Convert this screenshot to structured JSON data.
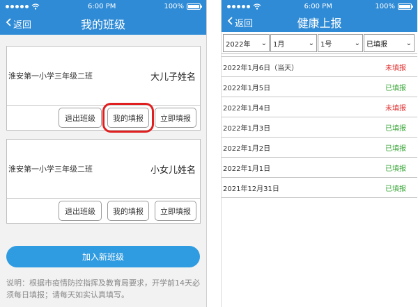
{
  "status_bar": {
    "carrier_dots": 5,
    "time": "6:00 PM",
    "battery": "100%"
  },
  "left": {
    "nav": {
      "back_label": "返回",
      "title": "我的班级"
    },
    "cards": [
      {
        "class_name": "淮安第一小学三年级二班",
        "child_name": "大儿子姓名",
        "buttons": {
          "exit": "退出班级",
          "my_report": "我的填报",
          "report_now": "立即填报"
        }
      },
      {
        "class_name": "淮安第一小学三年级二班",
        "child_name": "小女儿姓名",
        "buttons": {
          "exit": "退出班级",
          "my_report": "我的填报",
          "report_now": "立即填报"
        }
      }
    ],
    "join_button": "加入新班级",
    "note": "说明：根据市疫情防控指挥及教育局要求，开学前14天必须每日填报；请每天如实认真填写。"
  },
  "right": {
    "nav": {
      "back_label": "返回",
      "title": "健康上报"
    },
    "filters": {
      "year": "2022年",
      "month": "1月",
      "day": "1号",
      "status": "已填报"
    },
    "records": [
      {
        "date": "2022年1月6日（当天）",
        "status": "未填报",
        "filled": false
      },
      {
        "date": "2022年1月5日",
        "status": "已填报",
        "filled": true
      },
      {
        "date": "2022年1月4日",
        "status": "未填报",
        "filled": false
      },
      {
        "date": "2022年1月3日",
        "status": "已填报",
        "filled": true
      },
      {
        "date": "2022年1月2日",
        "status": "已填报",
        "filled": true
      },
      {
        "date": "2022年1月1日",
        "status": "已填报",
        "filled": true
      },
      {
        "date": "2021年12月31日",
        "status": "已填报",
        "filled": true
      }
    ]
  },
  "colors": {
    "brand": "#2f8bd6",
    "unfilled": "#e03030",
    "filled": "#3aa639",
    "highlight": "#e02020"
  }
}
